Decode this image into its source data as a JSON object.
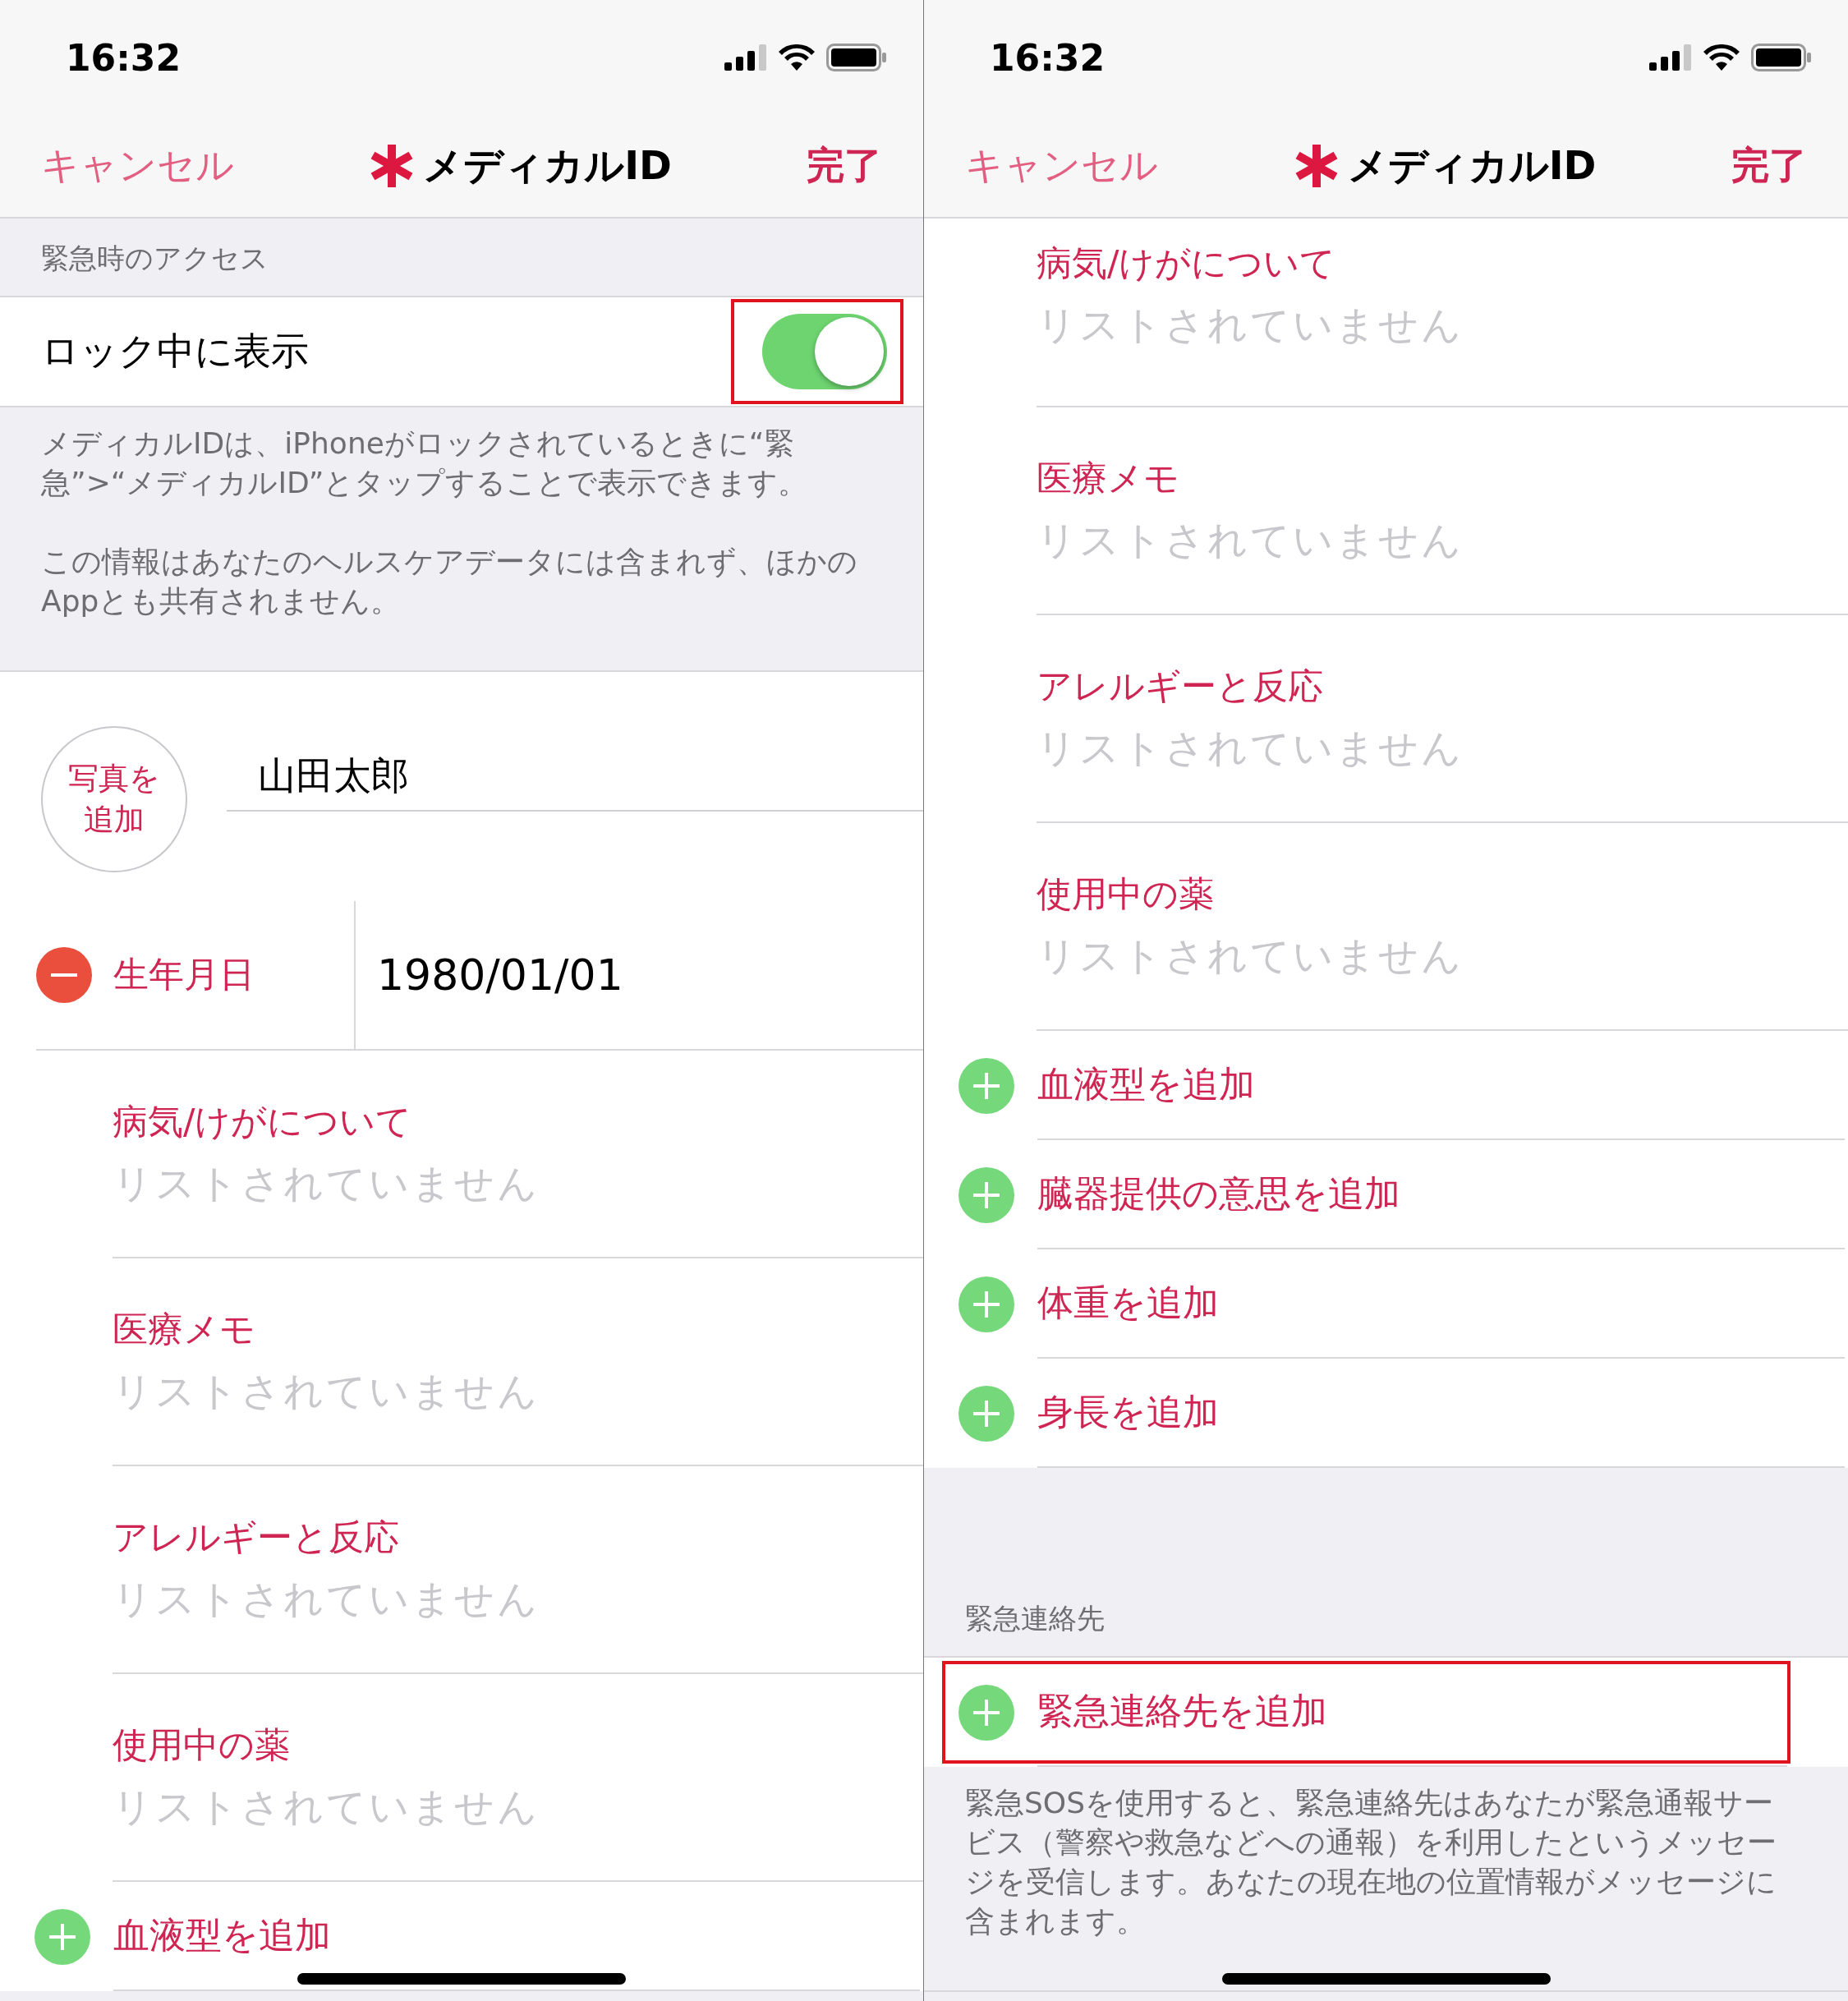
{
  "panels": [
    {
      "status_bar": {
        "time": "16:32"
      },
      "nav": {
        "cancel": "キャンセル",
        "title": "メディカルID",
        "done": "完了"
      },
      "items": [
        {
          "kind": "header",
          "text": "緊急時のアクセス"
        },
        {
          "kind": "toggle",
          "label": "ロック中に表示",
          "on": true,
          "highlighted": true
        },
        {
          "kind": "footer",
          "paragraphs": [
            "メディカルIDは、iPhoneがロックされているときに“緊急”>“メディカルID”とタップすることで表示できます。",
            "この情報はあなたのヘルスケアデータには含まれず、ほかのAppとも共有されません。"
          ]
        },
        {
          "kind": "profile",
          "photo_lines": [
            "写真を",
            "追加"
          ],
          "name": "山田太郎"
        },
        {
          "kind": "field",
          "label": "生年月日",
          "value": "1980/01/01"
        },
        {
          "kind": "info",
          "label": "病気/けがについて",
          "placeholder": "リストされていません"
        },
        {
          "kind": "info",
          "label": "医療メモ",
          "placeholder": "リストされていません"
        },
        {
          "kind": "info",
          "label": "アレルギーと反応",
          "placeholder": "リストされていません"
        },
        {
          "kind": "info",
          "label": "使用中の薬",
          "placeholder": "リストされていません"
        },
        {
          "kind": "add",
          "label": "血液型を追加",
          "highlighted": false
        }
      ]
    },
    {
      "status_bar": {
        "time": "16:32"
      },
      "nav": {
        "cancel": "キャンセル",
        "title": "メディカルID",
        "done": "完了"
      },
      "items": [
        {
          "kind": "info",
          "label": "病気/けがについて",
          "placeholder": "リストされていません"
        },
        {
          "kind": "info",
          "label": "医療メモ",
          "placeholder": "リストされていません"
        },
        {
          "kind": "info",
          "label": "アレルギーと反応",
          "placeholder": "リストされていません"
        },
        {
          "kind": "info",
          "label": "使用中の薬",
          "placeholder": "リストされていません"
        },
        {
          "kind": "add",
          "label": "血液型を追加",
          "highlighted": false
        },
        {
          "kind": "add",
          "label": "臓器提供の意思を追加",
          "highlighted": false
        },
        {
          "kind": "add",
          "label": "体重を追加",
          "highlighted": false
        },
        {
          "kind": "add",
          "label": "身長を追加",
          "highlighted": false
        },
        {
          "kind": "spacer"
        },
        {
          "kind": "header",
          "text": "緊急連絡先"
        },
        {
          "kind": "add",
          "label": "緊急連絡先を追加",
          "highlighted": true
        },
        {
          "kind": "footer",
          "paragraphs": [
            "緊急SOSを使用すると、緊急連絡先はあなたが緊急通報サービス（警察や救急などへの通報）を利用したというメッセージを受信します。あなたの現在地の位置情報がメッセージに含まれます。"
          ]
        }
      ]
    }
  ]
}
